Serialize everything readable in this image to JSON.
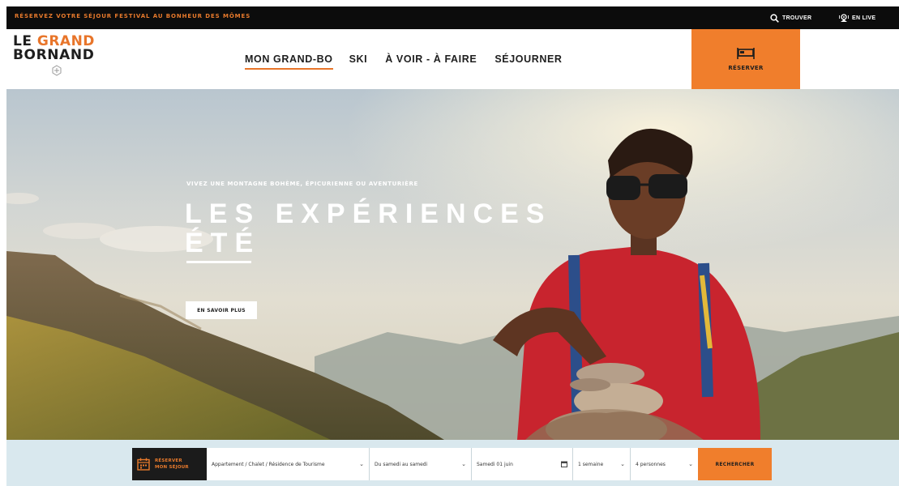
{
  "topbar": {
    "promo": "RÉSERVEZ VOTRE SÉJOUR FESTIVAL AU BONHEUR DES MÔMES",
    "search_label": "TROUVER",
    "live_label": "EN LIVE"
  },
  "logo": {
    "line1_a": "LE ",
    "line1_b": "GRAND",
    "line2": "BORNAND"
  },
  "nav": {
    "items": [
      "MON GRAND-BO",
      "SKI",
      "À VOIR - À FAIRE",
      "SÉJOURNER"
    ]
  },
  "reserve": {
    "label": "RÉSERVER"
  },
  "hero": {
    "kicker": "VIVEZ UNE MONTAGNE BOHÈME, ÉPICURIENNE OU AVENTURIÈRE",
    "title_line1": "LES EXPÉRIENCES",
    "title_line2": "ÉTÉ",
    "cta": "EN SAVOIR PLUS"
  },
  "booking": {
    "label_line1": "RÉSERVER",
    "label_line2": "MON SÉJOUR",
    "accommodation": "Appartement / Chalet / Résidence de Tourisme",
    "period": "Du samedi au samedi",
    "date": "Samedi 01 juin",
    "duration": "1 semaine",
    "people": "4 personnes",
    "search": "RECHERCHER"
  },
  "colors": {
    "accent": "#f07e2c",
    "dark": "#0c0c0c",
    "booking_bg": "#d9e8ee"
  }
}
